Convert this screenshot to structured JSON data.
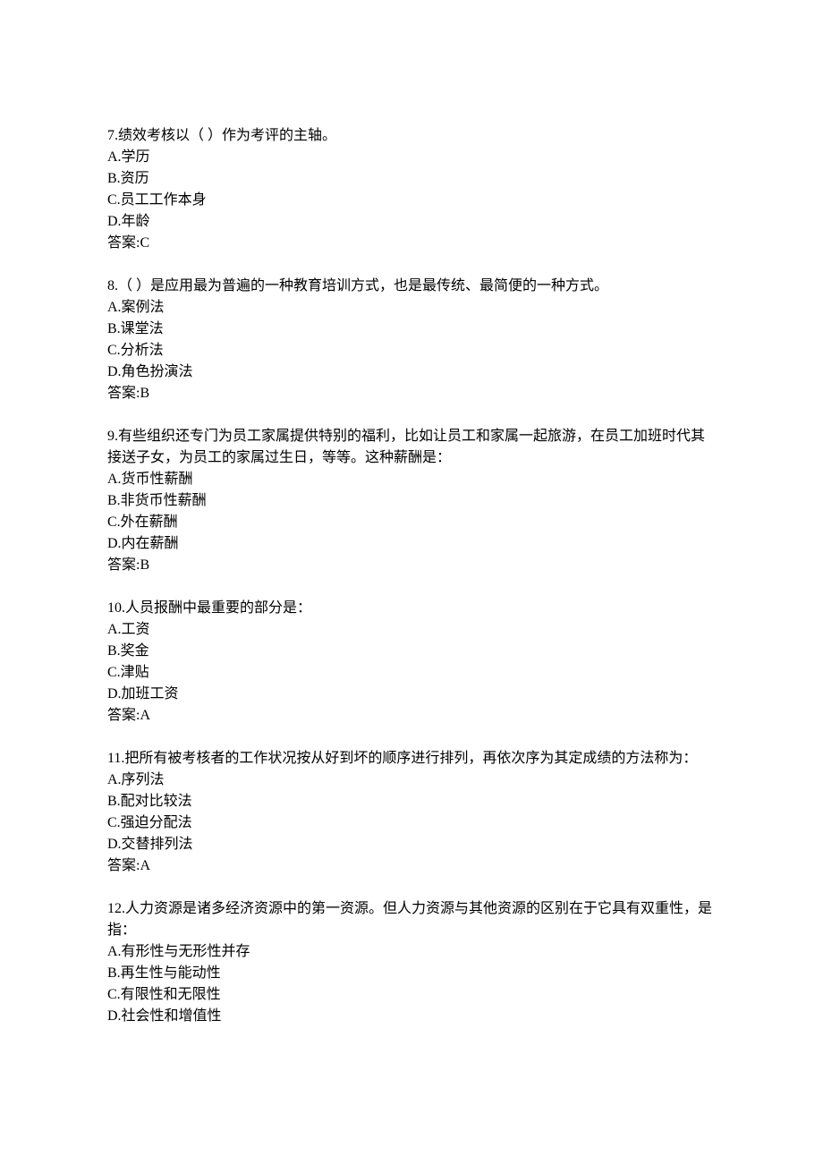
{
  "questions": [
    {
      "num": "7",
      "stem": "绩效考核以（ ）作为考评的主轴。",
      "options": [
        "A.学历",
        "B.资历",
        "C.员工工作本身",
        "D.年龄"
      ],
      "answer": "答案:C"
    },
    {
      "num": "8",
      "stem": "（ ）是应用最为普遍的一种教育培训方式，也是最传统、最简便的一种方式。",
      "options": [
        "A.案例法",
        "B.课堂法",
        "C.分析法",
        "D.角色扮演法"
      ],
      "answer": "答案:B"
    },
    {
      "num": "9",
      "stem": "有些组织还专门为员工家属提供特别的福利，比如让员工和家属一起旅游，在员工加班时代其接送子女，为员工的家属过生日，等等。这种薪酬是：",
      "options": [
        "A.货币性薪酬",
        "B.非货币性薪酬",
        "C.外在薪酬",
        "D.内在薪酬"
      ],
      "answer": "答案:B"
    },
    {
      "num": "10",
      "stem": "人员报酬中最重要的部分是：",
      "options": [
        "A.工资",
        "B.奖金",
        "C.津贴",
        "D.加班工资"
      ],
      "answer": "答案:A"
    },
    {
      "num": "11",
      "stem": "把所有被考核者的工作状况按从好到坏的顺序进行排列，再依次序为其定成绩的方法称为：",
      "options": [
        "A.序列法",
        "B.配对比较法",
        "C.强迫分配法",
        "D.交替排列法"
      ],
      "answer": "答案:A"
    },
    {
      "num": "12",
      "stem": "人力资源是诸多经济资源中的第一资源。但人力资源与其他资源的区别在于它具有双重性，是指：",
      "options": [
        "A.有形性与无形性并存",
        "B.再生性与能动性",
        "C.有限性和无限性",
        "D.社会性和增值性"
      ],
      "answer": ""
    }
  ]
}
